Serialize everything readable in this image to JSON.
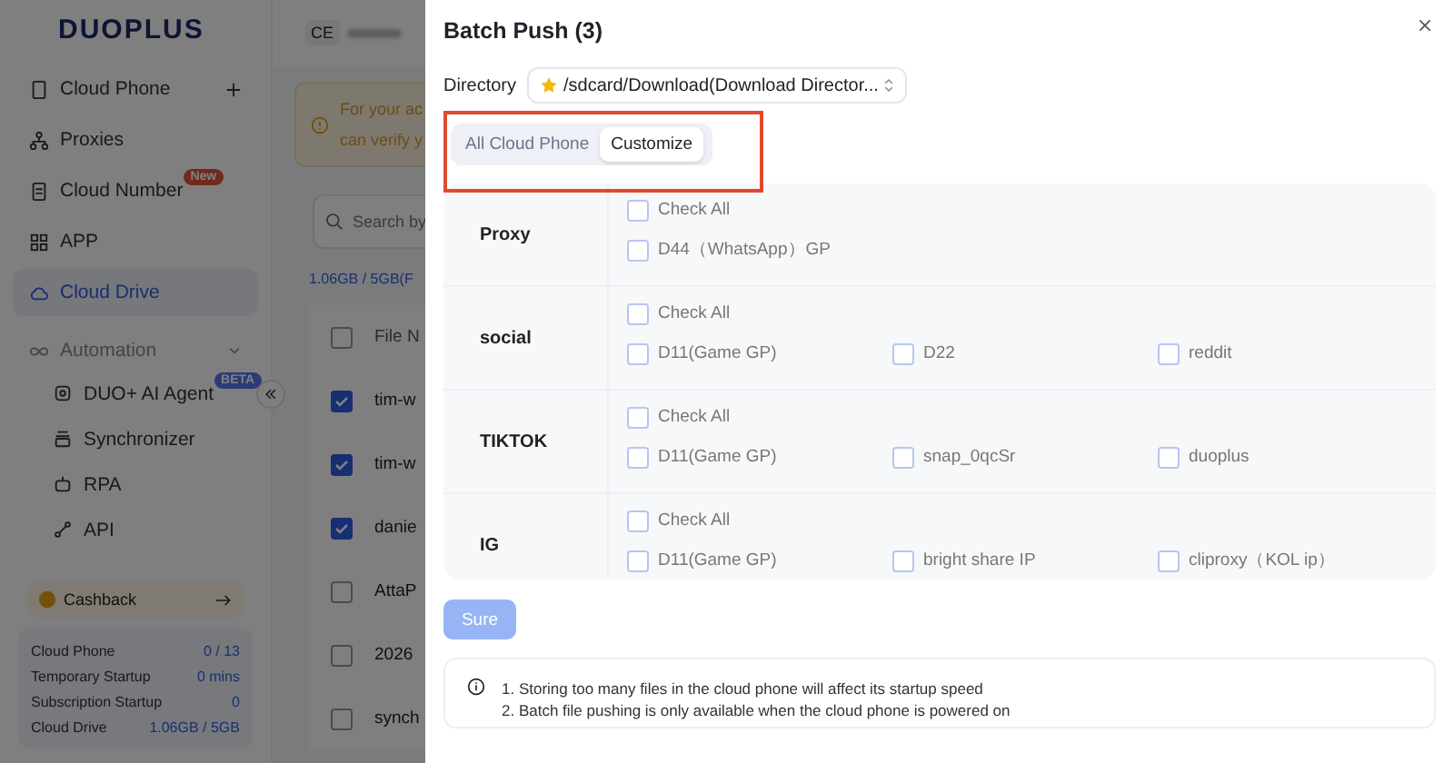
{
  "sidebar": {
    "logo": "DUOPLUS",
    "items": [
      {
        "label": "Cloud Phone",
        "selected": false
      },
      {
        "label": "Proxies",
        "selected": false
      },
      {
        "label": "Cloud Number",
        "selected": false,
        "badge": "New"
      },
      {
        "label": "APP",
        "selected": false
      },
      {
        "label": "Cloud Drive",
        "selected": true
      }
    ],
    "section": {
      "title": "Automation",
      "expanded": true,
      "items": [
        {
          "label": "DUO+ AI Agent",
          "badge": "BETA"
        },
        {
          "label": "Synchronizer"
        },
        {
          "label": "RPA"
        },
        {
          "label": "API"
        }
      ]
    },
    "cashback": "Cashback",
    "stats": [
      {
        "label": "Cloud Phone",
        "value": "0 / 13"
      },
      {
        "label": "Temporary Startup",
        "value": "0 mins"
      },
      {
        "label": "Subscription Startup",
        "value": "0"
      },
      {
        "label": "Cloud Drive",
        "value": "1.06GB / 5GB"
      }
    ]
  },
  "main": {
    "account": "CE",
    "notice": [
      "For your ac",
      "can verify y"
    ],
    "search": {
      "placeholder": "Search by"
    },
    "usage": "1.06GB / 5GB(F",
    "column": "File N",
    "all_selected": false,
    "rows": [
      {
        "name": "tim-w",
        "selected": true
      },
      {
        "name": "tim-w",
        "selected": true
      },
      {
        "name": "danie",
        "selected": true
      },
      {
        "name": "AttaP",
        "selected": false
      },
      {
        "name": "2026",
        "selected": false
      },
      {
        "name": "synch",
        "selected": false
      }
    ]
  },
  "dialog": {
    "title": "Batch Push (3)",
    "directory_label": "Directory",
    "directory": "/sdcard/Download(Download Director...",
    "tabs": [
      {
        "label": "All Cloud Phone",
        "selected": false
      },
      {
        "label": "Customize",
        "selected": true
      }
    ],
    "groups": [
      {
        "name": "Proxy",
        "check_all": {
          "label": "Check All",
          "checked": false
        },
        "members": [
          {
            "label": "D44（WhatsApp）GP",
            "checked": false
          }
        ]
      },
      {
        "name": "social",
        "check_all": {
          "label": "Check All",
          "checked": false
        },
        "members": [
          {
            "label": "D11(Game GP)",
            "checked": false
          },
          {
            "label": "D22",
            "checked": false
          },
          {
            "label": "reddit",
            "checked": false
          }
        ]
      },
      {
        "name": "TIKTOK",
        "check_all": {
          "label": "Check All",
          "checked": false
        },
        "members": [
          {
            "label": "D11(Game GP)",
            "checked": false
          },
          {
            "label": "snap_0qcSr",
            "checked": false
          },
          {
            "label": "duoplus",
            "checked": false
          }
        ]
      },
      {
        "name": "IG",
        "check_all": {
          "label": "Check All",
          "checked": false
        },
        "members": [
          {
            "label": "D11(Game GP)",
            "checked": false
          },
          {
            "label": "bright share IP",
            "checked": false
          },
          {
            "label": "cliproxy（KOL ip）",
            "checked": false
          }
        ]
      }
    ],
    "submit": {
      "label": "Sure",
      "disabled": true
    },
    "notes": [
      "1. Storing too many files in the cloud phone will affect its startup speed",
      "2. Batch file pushing is only available when the cloud phone is powered on"
    ]
  }
}
